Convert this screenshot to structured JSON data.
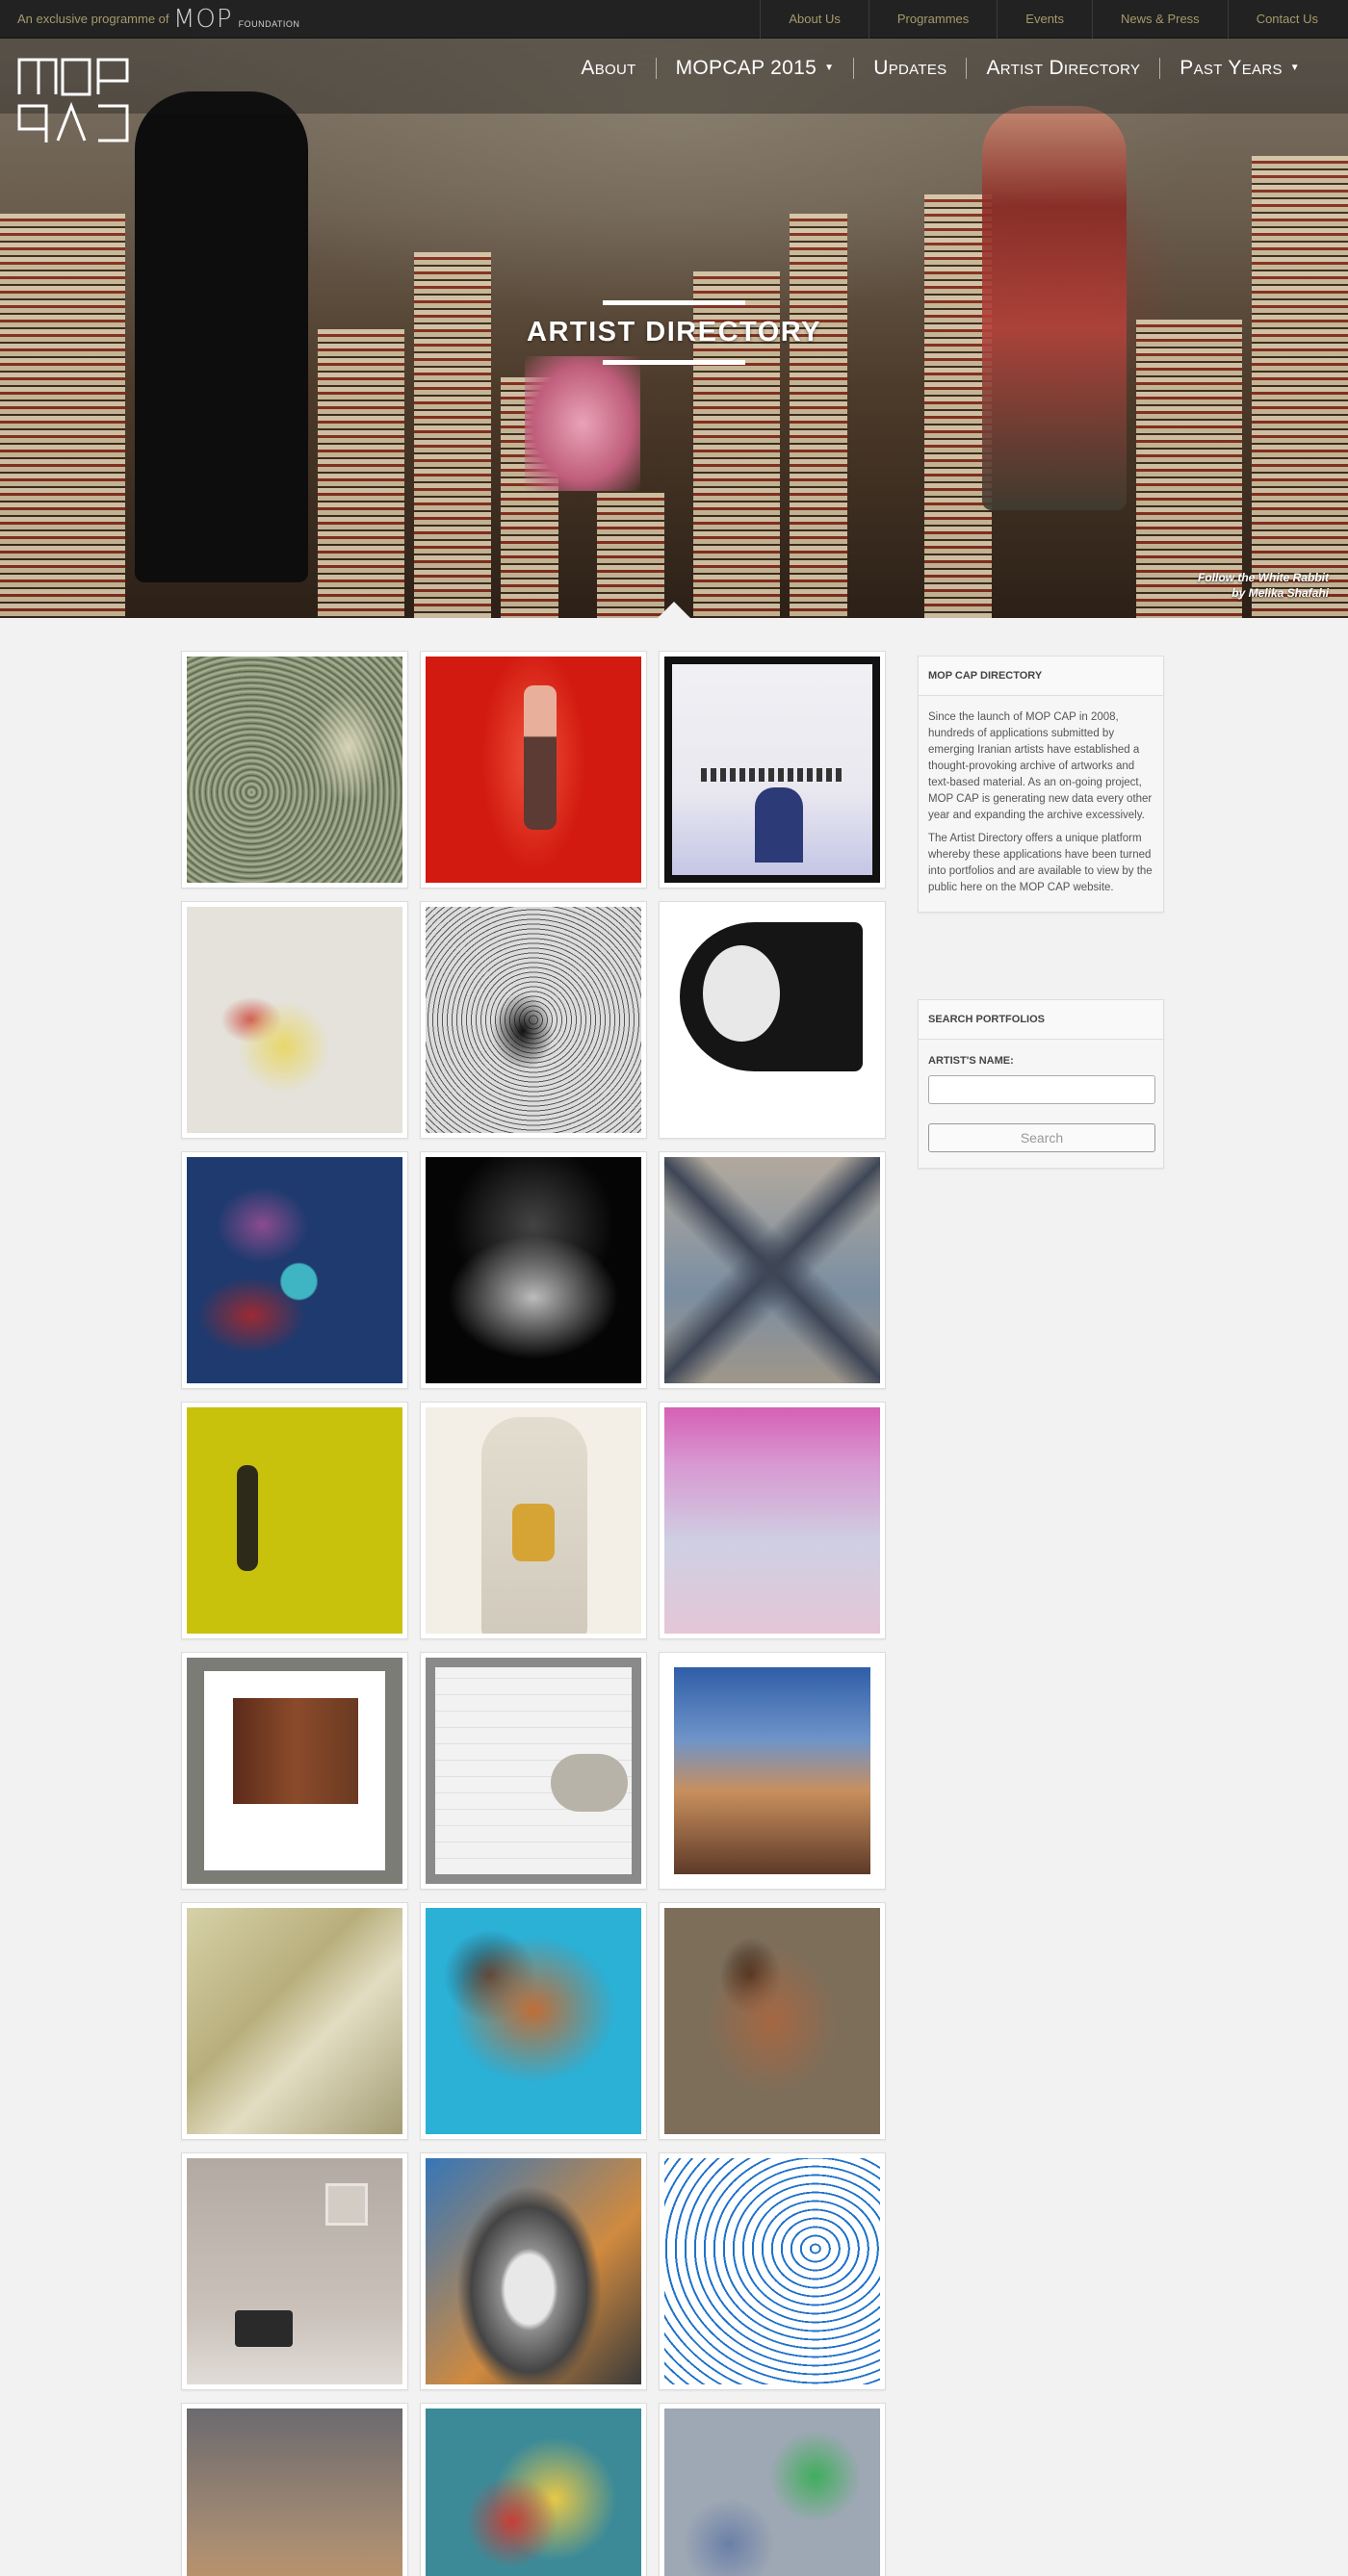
{
  "topbar": {
    "programme_text": "An exclusive programme of",
    "foundation_logo_text": "MOP",
    "foundation_word": "FOUNDATION",
    "links": [
      "About Us",
      "Programmes",
      "Events",
      "News & Press",
      "Contact Us"
    ]
  },
  "header": {
    "logo_text": "MOP CAP",
    "nav": [
      {
        "label": "About",
        "dropdown": false
      },
      {
        "label": "MOPCAP 2015",
        "dropdown": true
      },
      {
        "label": "Updates",
        "dropdown": false
      },
      {
        "label": "Artist Directory",
        "dropdown": false
      },
      {
        "label": "Past Years",
        "dropdown": true
      }
    ]
  },
  "hero": {
    "title": "ARTIST DIRECTORY",
    "caption_line1": "Follow the White Rabbit",
    "caption_line2": "by Melika Shafahi"
  },
  "sidebar": {
    "about_heading": "MOP CAP DIRECTORY",
    "about_paragraph1": "Since the launch of MOP CAP in 2008, hundreds of applications submitted by emerging Iranian artists have established a thought-provoking archive of artworks and text-based material. As an on-going project, MOP CAP is generating new data every other year and expanding the archive excessively.",
    "about_paragraph2": "The Artist Directory offers a unique platform whereby these applications have been turned into portfolios and are available to view by the public here on the MOP CAP website.",
    "search_heading": "SEARCH PORTFOLIOS",
    "search_label": "ARTIST'S NAME:",
    "search_button": "Search"
  },
  "colors": {
    "topbar_bg": "#222222",
    "topbar_link": "#a59a6b",
    "page_bg": "#f2f2f2"
  }
}
